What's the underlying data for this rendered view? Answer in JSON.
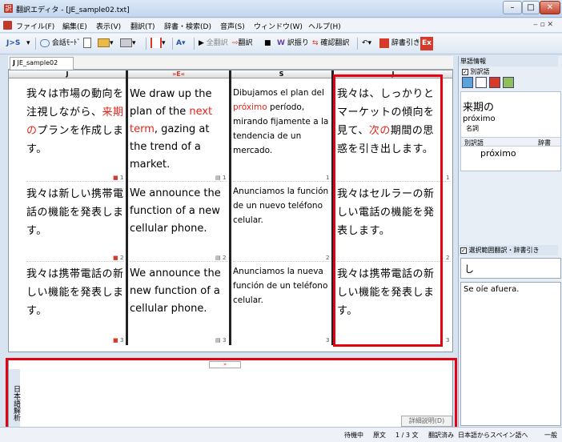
{
  "window": {
    "title": "翻訳エディタ - [JE_sample02.txt]",
    "app_icon": "訳"
  },
  "menubar": [
    {
      "label": "ファイル(F)"
    },
    {
      "label": "編集(E)"
    },
    {
      "label": "表示(V)"
    },
    {
      "label": "翻訳(T)"
    },
    {
      "label": "辞書・検索(D)"
    },
    {
      "label": "音声(S)"
    },
    {
      "label": "ウィンドウ(W)"
    },
    {
      "label": "ヘルプ(H)"
    }
  ],
  "toolbar": {
    "js_label": "J>S",
    "conversation_mode": "会話ﾓｰﾄﾞ",
    "translate_all": "全翻訳",
    "translate": "翻訳",
    "reverse_translate": "訳振り",
    "confirm_translate": "確認翻訳",
    "dictionary_lookup": "辞書引き",
    "ex_label": "Ex"
  },
  "document": {
    "tab_label": "JE_sample02",
    "columns": [
      {
        "header": "J"
      },
      {
        "header": "»E«"
      },
      {
        "header": "S"
      },
      {
        "header": "J"
      }
    ],
    "rows": [
      {
        "ja_source": "我々は市場の動向を注視しながら、来期のプランを作成します。",
        "ja_source_parts": [
          "我々は市場の動向を注視しながら、",
          "来期の",
          "プランを作成します。"
        ],
        "en_parts": [
          "We draw up the plan of the ",
          "next term",
          ", gazing at the trend of a market."
        ],
        "es_parts": [
          "Dibujamos el plan del ",
          "próximo",
          " período, mirando fijamente a la tendencia de un mercado."
        ],
        "ja_back_parts": [
          "我々は、しっかりとマーケットの傾向を見て、",
          "次の",
          "期間の思惑を引き出します。"
        ],
        "number": "1"
      },
      {
        "ja_source": "我々は新しい携帯電話の機能を発表します。",
        "en": "We announce the function of a new cellular phone.",
        "es": "Anunciamos la función de un nuevo teléfono celular.",
        "ja_back": "我々はセルラーの新しい電話の機能を発表します。",
        "number": "2"
      },
      {
        "ja_source": "我々は携帯電話の新しい機能を発表します。",
        "en": "We announce the new function of a cellular phone.",
        "es": "Anunciamos la nueva función de un teléfono celular.",
        "ja_back": "我々は携帯電話の新しい機能を発表します。",
        "number": "3"
      }
    ]
  },
  "lower_panel": {
    "vertical_title": "日本語解析",
    "detail_button": "詳細説明(D)",
    "toggle": "»"
  },
  "sidebar": {
    "word_info_title": "単語情報",
    "alt_word_checkbox": "別訳語",
    "headword": "来期の",
    "reading": "próximo",
    "pos": "名詞",
    "table_headers": [
      "別訳語",
      "辞書"
    ],
    "table_rows": [
      "próximo"
    ],
    "lookup_title": "選択範囲翻訳・辞書引き",
    "lookup_input": "し",
    "lookup_result": "Se oíe afuera."
  },
  "statusbar": {
    "waiting": "待機中",
    "source": "原文",
    "position": "1 / 3 文",
    "translated": "翻訳済み",
    "direction": "日本語からスペイン語へ",
    "category": "一般"
  },
  "colors": {
    "highlight_red": "#e1251b",
    "box_red": "#e50012"
  }
}
